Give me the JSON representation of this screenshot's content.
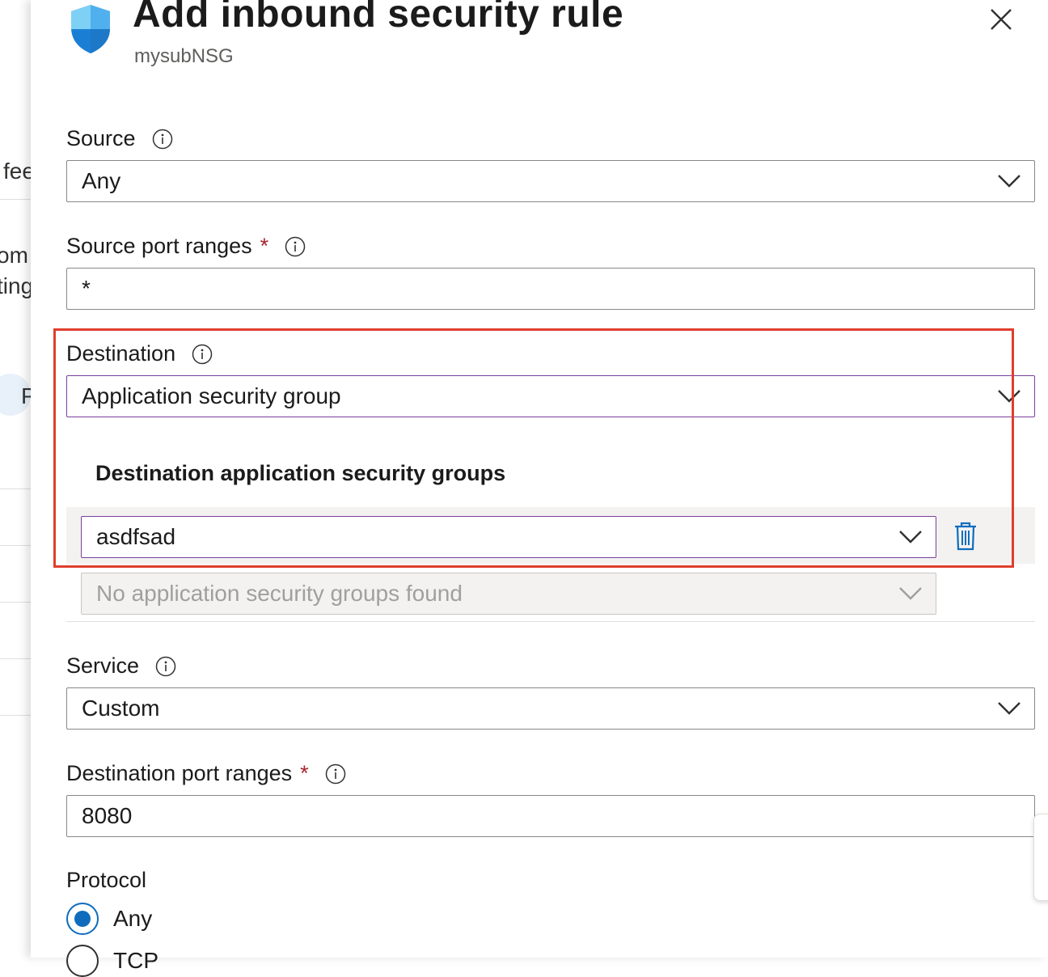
{
  "background": {
    "fragments": [
      "fee",
      "om",
      "ting",
      "P"
    ]
  },
  "header": {
    "title": "Add inbound security rule",
    "subtitle": "mysubNSG",
    "icon": "shield-icon",
    "close_icon": "close-icon"
  },
  "source": {
    "label": "Source",
    "value": "Any"
  },
  "source_port_ranges": {
    "label": "Source port ranges",
    "required_marker": "*",
    "value": "*"
  },
  "destination": {
    "label": "Destination",
    "value": "Application security group",
    "asg_heading": "Destination application security groups",
    "asg_selected": "asdfsad",
    "asg_empty_placeholder": "No application security groups found"
  },
  "service": {
    "label": "Service",
    "value": "Custom"
  },
  "destination_port_ranges": {
    "label": "Destination port ranges",
    "required_marker": "*",
    "value": "8080"
  },
  "protocol": {
    "label": "Protocol",
    "options": [
      "Any",
      "TCP"
    ],
    "selected": "Any"
  },
  "colors": {
    "accent": "#0f6cbd",
    "focus_border": "#7b3f9e",
    "highlight_box": "#e03e2d",
    "required": "#a4262c"
  }
}
